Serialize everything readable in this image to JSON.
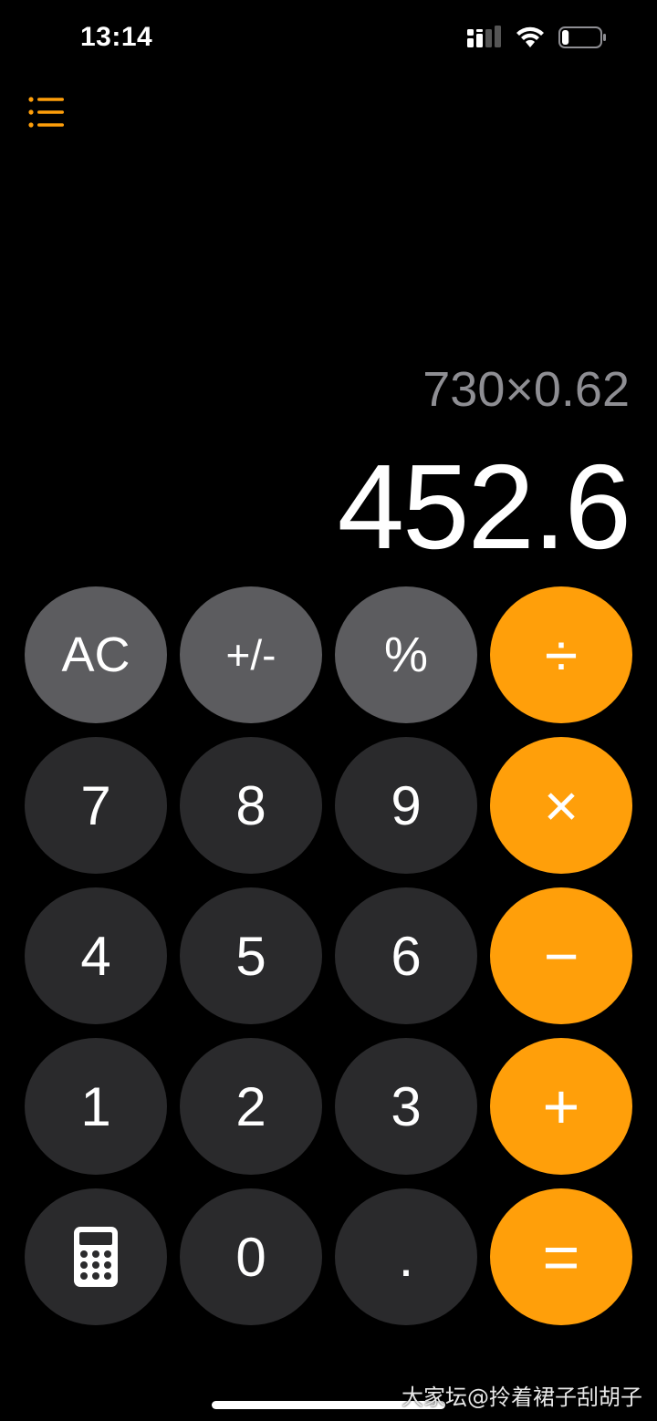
{
  "status_bar": {
    "time": "13:14",
    "battery_level": 0.18,
    "icons": [
      "cellular-signal-icon",
      "wifi-icon",
      "battery-icon"
    ]
  },
  "header": {
    "icon": "list-icon"
  },
  "display": {
    "expression": "730×0.62",
    "result": "452.6"
  },
  "keys": {
    "clear": "AC",
    "plus_minus": "+/-",
    "percent": "%",
    "divide": "÷",
    "seven": "7",
    "eight": "8",
    "nine": "9",
    "multiply": "×",
    "four": "4",
    "five": "5",
    "six": "6",
    "subtract": "−",
    "one": "1",
    "two": "2",
    "three": "3",
    "add": "+",
    "calculator_icon": "calculator-icon",
    "zero": "0",
    "decimal": ".",
    "equals": "="
  },
  "colors": {
    "accent": "#ff9f0a",
    "function_key": "#5c5c5f",
    "number_key": "#2a2a2c",
    "expression_text": "#8e8e93",
    "background": "#000000"
  },
  "watermark": "大家坛@拎着裙子刮胡子"
}
